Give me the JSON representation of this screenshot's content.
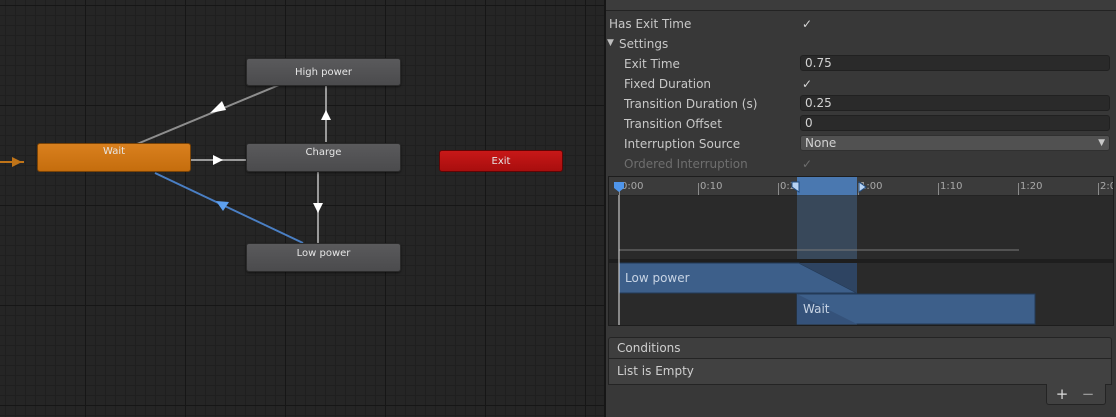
{
  "graph": {
    "states": {
      "wait": "Wait",
      "high_power": "High power",
      "charge": "Charge",
      "low_power": "Low power",
      "exit": "Exit"
    },
    "colors": {
      "default_state": "#d9801e",
      "exit_state": "#c81818",
      "selected_transition": "#4a86d4"
    }
  },
  "inspector": {
    "has_exit_time": {
      "label": "Has Exit Time",
      "checked": true
    },
    "settings_label": "Settings",
    "exit_time": {
      "label": "Exit Time",
      "value": "0.75"
    },
    "fixed_duration": {
      "label": "Fixed Duration",
      "checked": true
    },
    "transition_duration": {
      "label": "Transition Duration (s)",
      "value": "0.25"
    },
    "transition_offset": {
      "label": "Transition Offset",
      "value": "0"
    },
    "interruption_source": {
      "label": "Interruption Source",
      "value": "None"
    },
    "ordered_interruption": {
      "label": "Ordered Interruption",
      "checked": true
    },
    "timeline": {
      "ticks": [
        "0:00",
        "0:10",
        "0:20",
        "1:00",
        "1:10",
        "1:20",
        "2:0"
      ],
      "source_clip": "Low power",
      "dest_clip": "Wait"
    },
    "conditions": {
      "header": "Conditions",
      "empty_text": "List is Empty",
      "add_symbol": "+",
      "remove_symbol": "−"
    }
  }
}
